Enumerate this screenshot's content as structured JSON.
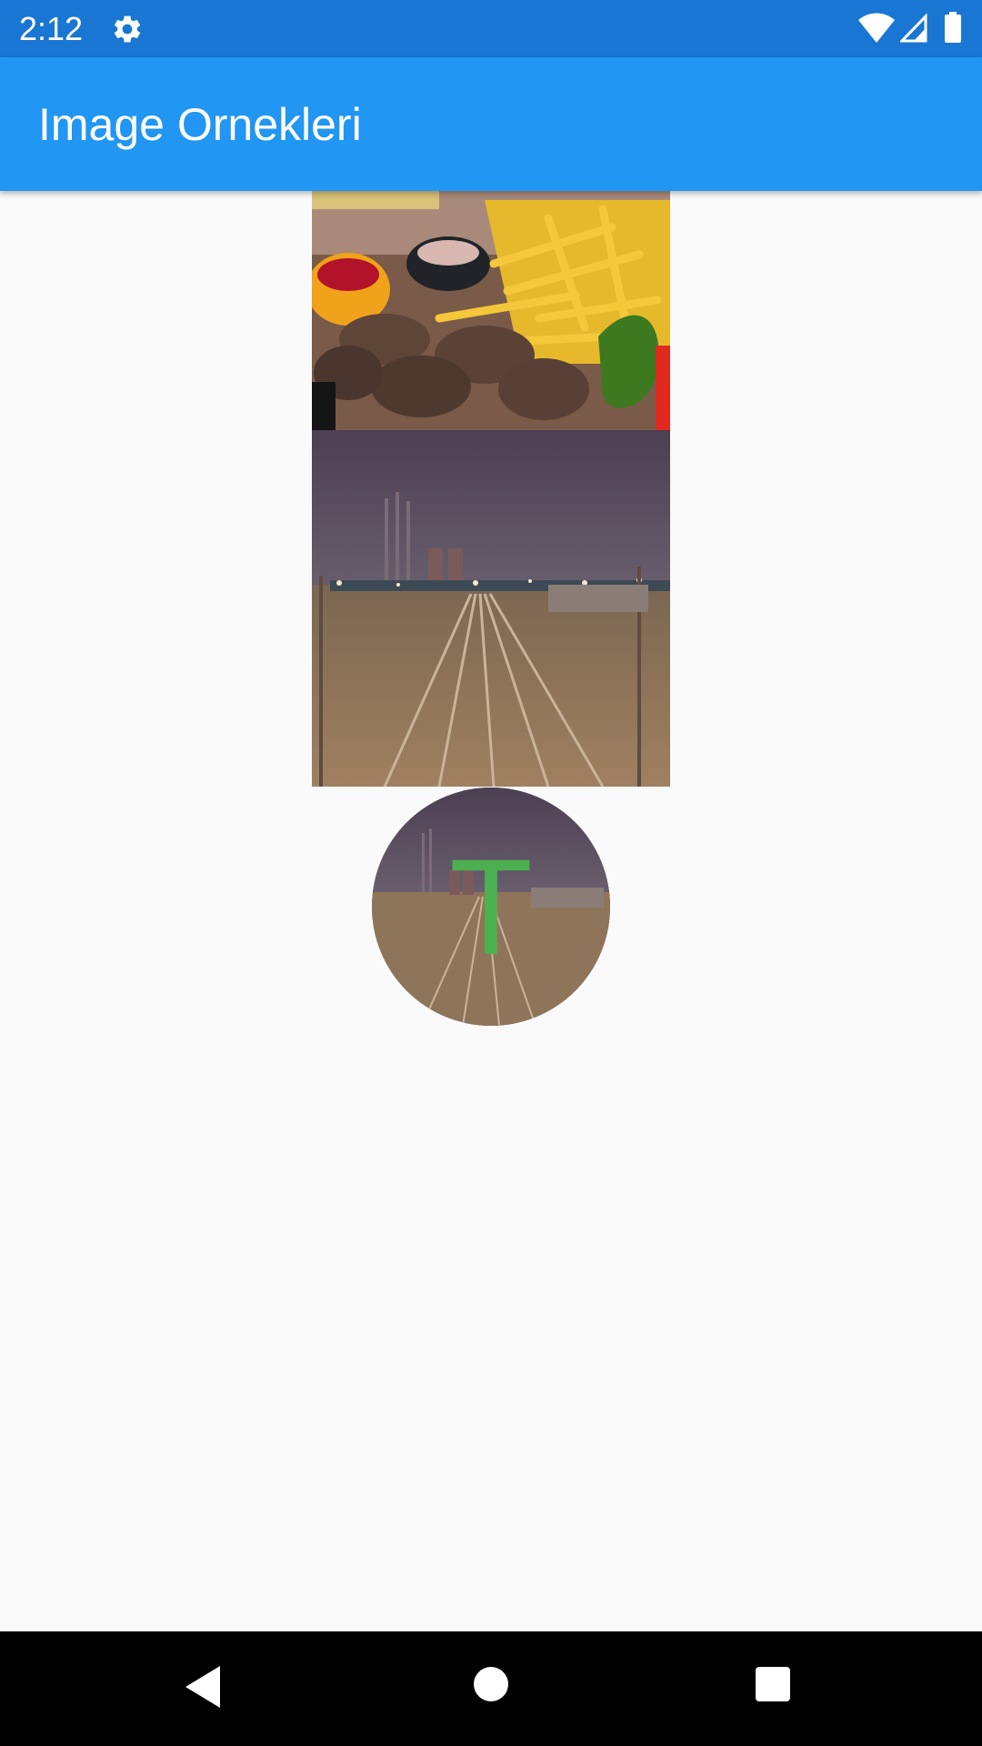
{
  "status_bar": {
    "time": "2:12",
    "icons": [
      "settings-icon",
      "wifi-icon",
      "signal-icon",
      "battery-icon"
    ]
  },
  "app_bar": {
    "title": "Image Ornekleri",
    "color": "#2196f3"
  },
  "images": [
    {
      "name": "food-image",
      "subject": "grilled meatballs with fries"
    },
    {
      "name": "railway-image",
      "subject": "railway tracks at night"
    }
  ],
  "avatar": {
    "letter": "T",
    "letter_color": "#4caf50"
  },
  "nav_bar": {
    "icons": [
      "back-icon",
      "home-icon",
      "recents-icon"
    ]
  }
}
